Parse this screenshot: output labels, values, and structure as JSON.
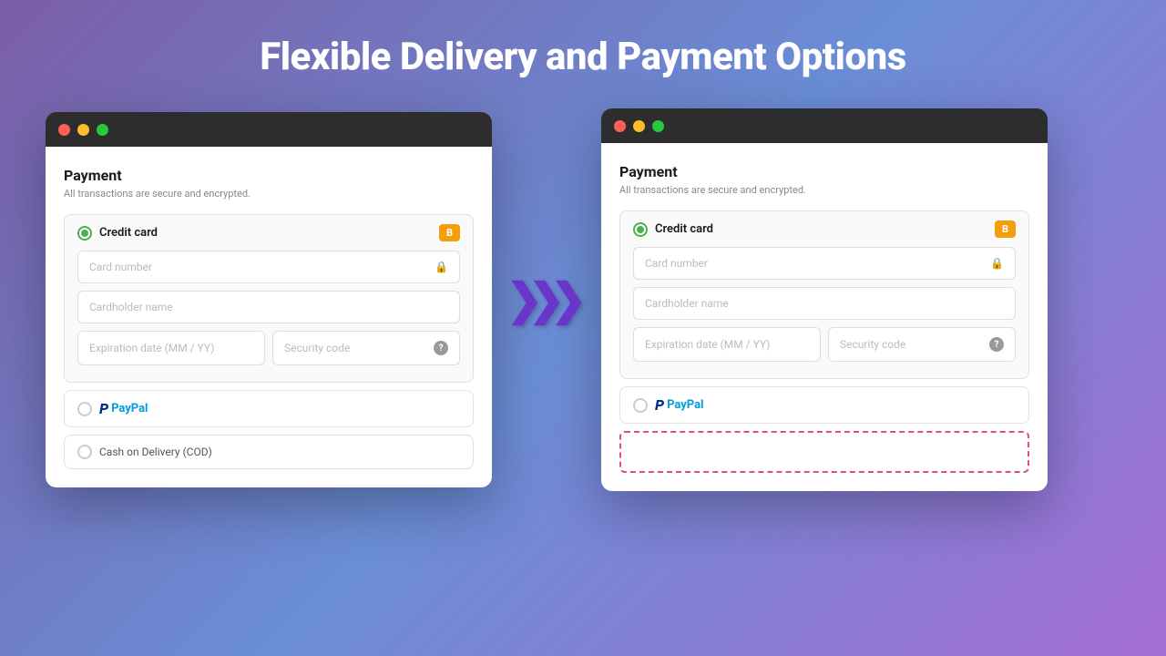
{
  "page": {
    "title": "Flexible Delivery and Payment Options"
  },
  "left_window": {
    "titlebar": {
      "lights": [
        "red",
        "yellow",
        "green"
      ]
    },
    "payment": {
      "title": "Payment",
      "subtitle": "All transactions are secure and encrypted.",
      "credit_card_label": "Credit card",
      "badge": "B",
      "card_number_placeholder": "Card number",
      "cardholder_placeholder": "Cardholder name",
      "expiry_placeholder": "Expiration date (MM / YY)",
      "security_placeholder": "Security code",
      "paypal_label": "PayPal",
      "cod_label": "Cash on Delivery (COD)"
    }
  },
  "right_window": {
    "titlebar": {
      "lights": [
        "red",
        "yellow",
        "green"
      ]
    },
    "payment": {
      "title": "Payment",
      "subtitle": "All transactions are secure and encrypted.",
      "credit_card_label": "Credit card",
      "badge": "B",
      "card_number_placeholder": "Card number",
      "cardholder_placeholder": "Cardholder name",
      "expiry_placeholder": "Expiration date (MM / YY)",
      "security_placeholder": "Security code",
      "paypal_label": "PayPal"
    }
  },
  "arrows": [
    "›",
    "›",
    "›"
  ]
}
